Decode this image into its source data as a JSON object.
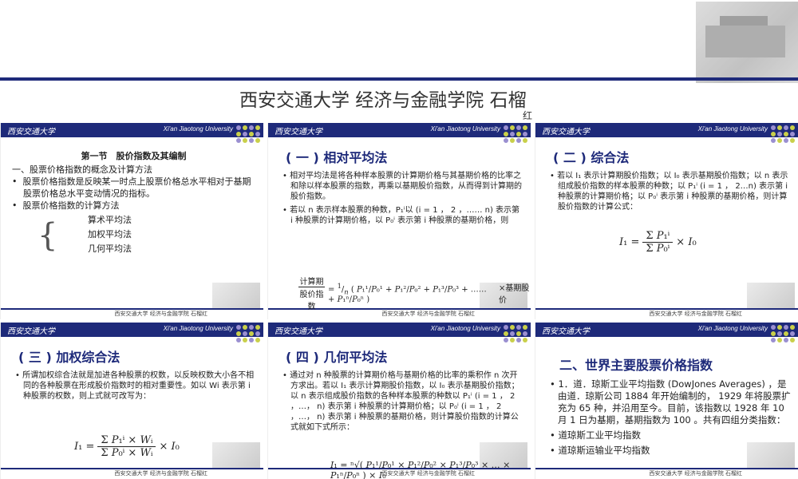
{
  "banner": {
    "title": "西安交通大学 经济与金融学院 石榴",
    "title_tail": "红"
  },
  "common": {
    "logo_text": "西安交通大学",
    "university_en": "Xi'an Jiaotong University",
    "footer_text": "西安交通大学 经济与金融学院 石榴",
    "footer_tail": "红",
    "dot_colors": [
      "#9a8fd1",
      "#c9d04a",
      "#9a8fd1",
      "#c9d04a",
      "#c9d04a",
      "#9a8fd1",
      "#c9d04a",
      "#9a8fd1",
      "#9a8fd1",
      "#c9d04a",
      "#9a8fd1",
      "#c9d04a"
    ]
  },
  "slide1": {
    "heading": "第一节　股价指数及其编制",
    "line1": "一、股票价格指数的概念及计算方法",
    "bullet1": "股票价格指数是反映某一时点上股票价格总水平相对于基期股票价格总水平变动情况的指标。",
    "bullet2": "股票价格指数的计算方法",
    "method1": "算术平均法",
    "method2": "加权平均法",
    "method3": "几何平均法"
  },
  "slide2": {
    "title": "( 一 ) 相对平均法",
    "bullet1": "相对平均法是将各种样本股票的计算期价格与其基期价格的比率之和除以样本股票的指数，再乘以基期股价指数，从而得到计算期的股价指数。",
    "bullet2": "若以 n 表示样本股票的种数，P₁ⁱ以 (i = 1 ， 2 ，…… n) 表示第 i 种股票的计算期价格，以 P₀ⁱ 表示第 i 种股票的基期价格，则",
    "formula_lhs1": "计算期",
    "formula_lhs2": "股价指数",
    "formula_rhs": "×基期股价"
  },
  "slide3": {
    "title": "( 二 ) 综合法",
    "bullet1": "若以 I₁ 表示计算期股价指数；以 I₀ 表示基期股价指数；以 n 表示组成股价指数的样本股票的种数；以 P₁ⁱ (i = 1 ， 2…n) 表示第 i 种股票的计算期价格；以 P₀ⁱ 表示第 i 种股票的基期价格，则计算股价指数的计算公式："
  },
  "slide4": {
    "title": "( 三 ) 加权综合法",
    "bullet1": "所谓加权综合法就是加进各种股票的权数，以反映权数大小各不相同的各种股票在形成股价指数时的相对重要性。如以 Wi 表示第 i 种股票的权数，则上式就可改写为："
  },
  "slide5": {
    "title": "( 四 ) 几何平均法",
    "bullet1": "通过对 n 种股票的计算期价格与基期价格的比率的乘积作 n 次开方求出。若以 I₁ 表示计算期股价指数，以 I₀ 表示基期股价指数；以 n 表示组成股价指数的各种样本股票的种数以 P₁ⁱ (i = 1 ， 2 ，…， n) 表示第 i 种股票的计算期价格；以 P₀ⁱ (i = 1 ， 2 ，…， n) 表示第 i 种股票的基期价格，则计算股价指数的计算公式就如下式所示："
  },
  "slide6": {
    "title": "二、世界主要股票价格指数",
    "bullet1": "1．道．琼斯工业平均指数 (DowJones Averages) ，是由道．琼斯公司 1884 年开始编制的， 1929 年将股票扩充为 65 种，并沿用至今。目前，该指数以 1928 年 10 月 1 日为基期，基期指数为 100 。共有四组分类指数：",
    "bullet2": "道琼斯工业平均指数",
    "bullet3": "道琼斯运输业平均指数"
  }
}
